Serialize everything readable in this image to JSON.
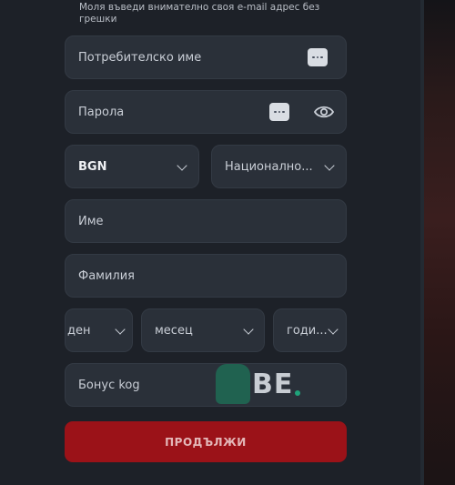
{
  "hint": "Моля въведи внимателно своя e-mail адрес без грешки",
  "fields": {
    "username": "Потребителско име",
    "password": "Парола",
    "currency": "BGN",
    "nationality": "Национално...",
    "first_name": "Име",
    "last_name": "Фамилия",
    "day": "ден",
    "month": "месец",
    "year": "годи...",
    "bonus_code": "Бонус kog"
  },
  "watermark": "BE",
  "submit_label": "ПРОДЪЛЖИ",
  "colors": {
    "accent": "#9b1218",
    "field_bg": "#2a3039",
    "page_bg": "#1d2128"
  },
  "icons": [
    "password-manager-icon",
    "show-password-eye-icon",
    "chevron-down-icon"
  ]
}
